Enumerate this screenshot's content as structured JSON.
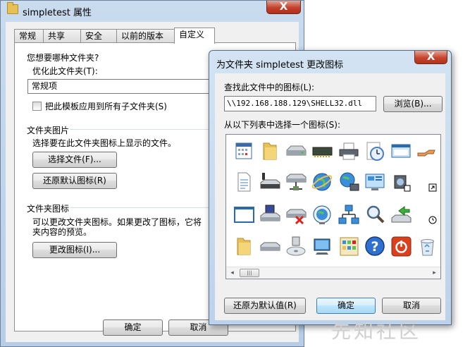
{
  "props_window": {
    "title": "simpletest 属性",
    "close_glyph": "X",
    "tabs": [
      "常规",
      "共享",
      "安全",
      "以前的版本",
      "自定义"
    ],
    "active_tab": "自定义",
    "folder_type_question": "您想要哪种文件夹?",
    "optimize_label": "优化此文件夹(T):",
    "optimize_value": "常规项",
    "apply_template_label": "把此模板应用到所有子文件夹(S)",
    "folder_pictures_title": "文件夹图片",
    "folder_pictures_desc": "选择要在此文件夹图标上显示的文件。",
    "choose_file_button": "选择文件(F)...",
    "restore_default_image_button": "还原默认图标(R)",
    "folder_icon_title": "文件夹图标",
    "folder_icon_desc_1": "可以更改文件夹图标。如果更改了图标，它将",
    "folder_icon_desc_2": "夹内容的预览。",
    "change_icon_button": "更改图标(I)...",
    "ok_button": "确定",
    "cancel_button": "取消"
  },
  "dialog": {
    "title": "为文件夹 simpletest 更改图标",
    "close_glyph": "X",
    "lookup_label": "查找此文件中的图标(L):",
    "path_value": "\\\\192.168.188.129\\SHELL32.dll",
    "browse_button": "浏览(B)...",
    "select_label": "从以下列表中选择一个图标(S):",
    "icons": [
      "calendar-icon",
      "folder-icon",
      "drive-icon",
      "memory-chip-icon",
      "printer-icon",
      "clock-icon",
      "window-icon",
      "share-hand-icon",
      "document-icon",
      "drive-disconnected-icon",
      "network-drive-icon",
      "globe-icon",
      "network-globe-icon",
      "monitor-settings-icon",
      "audio-shortcut-icon",
      "shortcut-arrow-icon",
      "blank-window-icon",
      "floppy-drive-icon",
      "drive-error-icon",
      "internet-globe-icon",
      "network-icon",
      "search-magnifier-icon",
      "network-share-icon",
      "timer-icon",
      "folder-icon",
      "cd-drive-icon",
      "cd-install-icon",
      "desktop-computer-icon",
      "control-panel-icon",
      "help-icon",
      "power-icon",
      "recycle-bin-icon"
    ],
    "scroll_left": "◂",
    "scroll_thumb": "|||",
    "scroll_right": "▸",
    "restore_button": "还原为默认值(R)",
    "ok_button": "确定",
    "cancel_button": "取消"
  },
  "watermark": "先知社区"
}
